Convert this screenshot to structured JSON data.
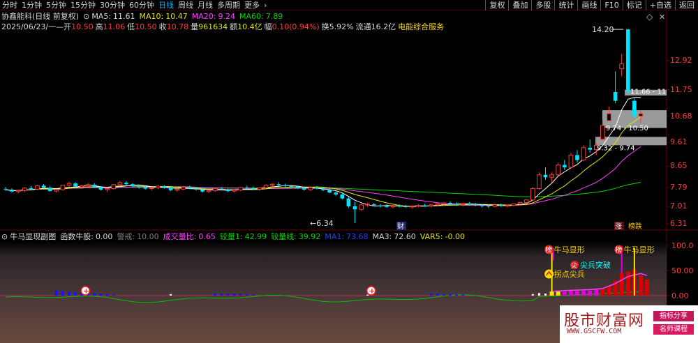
{
  "toolbar": {
    "timeframes": [
      "分时",
      "1分钟",
      "5分钟",
      "15分钟",
      "30分钟",
      "60分钟",
      "日线",
      "周线",
      "月线",
      "多周期",
      "更多"
    ],
    "active": "日线",
    "right_buttons": [
      "复权",
      "叠加",
      "多股",
      "统计",
      "画线",
      "F10",
      "标记",
      "+自选",
      "返回"
    ]
  },
  "stock": {
    "name": "协鑫能科",
    "adjust": "(日线 前复权)",
    "ma5_label": "MA5:",
    "ma5": "11.61",
    "ma10_label": "MA10:",
    "ma10": "10.47",
    "ma20_label": "MA20:",
    "ma20": "9.24",
    "ma60_label": "MA60:",
    "ma60": "7.89",
    "date": "2025/06/23/一",
    "open_label": "开",
    "open": "10.50",
    "high_label": "高",
    "high": "11.06",
    "low_label": "低",
    "low": "10.50",
    "close_label": "收",
    "close": "10.78",
    "vol_label": "量",
    "vol": "961634",
    "amt_label": "额",
    "amt": "10.4亿",
    "chg_label": "幅",
    "chg": "0.10(0.94%)",
    "turn_label": "换",
    "turn": "5.92%",
    "float_label": "流通",
    "float": "16.2亿",
    "sector": "电能综合服务",
    "close_x": "✕",
    "diamond": "◇"
  },
  "price_axis": [
    "12.92",
    "11.75",
    "10.68",
    "9.61",
    "8.65",
    "7.79",
    "7.01",
    "6.31"
  ],
  "annotations": {
    "high": "14.20",
    "low": "6.34",
    "gap1": "11.66 - 11",
    "gap2": "9.74 - 10.50",
    "gap3": "9.32 - 9.74",
    "cai": "财",
    "zhang": "涨",
    "bangdie": "榜跌"
  },
  "indicator": {
    "name": "牛马显现副图",
    "fn_label": "函数牛股:",
    "fn_value": "0.00",
    "warn_label": "警戒:",
    "warn_value": "10.00",
    "ratio_label": "成交量比:",
    "ratio_value": "0.65",
    "vol1_label": "较量1:",
    "vol1_value": "42.99",
    "volline_label": "较量线:",
    "volline_value": "39.92",
    "ma1_label": "MA1:",
    "ma1_value": "73.68",
    "ma3_label": "MA3:",
    "ma3_value": "72.60",
    "var5_label": "VAR5:",
    "var5_value": "-0.00",
    "axis": [
      "100.0",
      "50.00",
      "0.00"
    ],
    "tag_bang": "榜",
    "tag_niuma1": "牛马显形",
    "tag_niuma2": "牛马显形",
    "tag_guaidian": "拐点尖兵",
    "tag_jianbing": "尖兵突破",
    "badge_jian": "尖",
    "plus": "+"
  },
  "watermark": {
    "main": "股市财富网",
    "url": "WWW.GSCFW.COM",
    "tag1": "指标分享",
    "tag2": "名师课程"
  },
  "colors": {
    "up": "#ff3c3c",
    "down": "#00e5ff",
    "ma5": "#ffffff",
    "ma10": "#e7e700",
    "ma20": "#ff40ff",
    "ma60": "#00d700",
    "bar_blue": "#1414ff",
    "bar_magenta": "#e000e0",
    "bar_red": "#dd0000",
    "bar_yellow": "#ffe000"
  },
  "chart_data": {
    "type": "candlestick",
    "title": "协鑫能科 (日线 前复权)",
    "ylim": [
      6.2,
      14.6
    ],
    "candles": [
      [
        7.72,
        7.8,
        7.65,
        7.7
      ],
      [
        7.7,
        7.75,
        7.58,
        7.62
      ],
      [
        7.62,
        7.7,
        7.55,
        7.66
      ],
      [
        7.66,
        7.8,
        7.6,
        7.76
      ],
      [
        7.76,
        7.85,
        7.7,
        7.72
      ],
      [
        7.72,
        7.9,
        7.68,
        7.86
      ],
      [
        7.86,
        7.92,
        7.75,
        7.78
      ],
      [
        7.78,
        7.85,
        7.62,
        7.64
      ],
      [
        7.64,
        7.72,
        7.58,
        7.7
      ],
      [
        7.7,
        7.9,
        7.66,
        7.88
      ],
      [
        7.88,
        8.02,
        7.82,
        7.95
      ],
      [
        7.95,
        8.0,
        7.8,
        7.82
      ],
      [
        7.82,
        7.9,
        7.74,
        7.86
      ],
      [
        7.86,
        7.96,
        7.8,
        7.9
      ],
      [
        7.9,
        7.96,
        7.76,
        7.78
      ],
      [
        7.78,
        7.84,
        7.66,
        7.7
      ],
      [
        7.7,
        7.78,
        7.6,
        7.74
      ],
      [
        7.74,
        7.92,
        7.7,
        7.9
      ],
      [
        7.9,
        8.05,
        7.84,
        7.98
      ],
      [
        7.98,
        8.04,
        7.88,
        7.92
      ],
      [
        7.92,
        7.96,
        7.8,
        7.84
      ],
      [
        7.84,
        7.9,
        7.74,
        7.8
      ],
      [
        7.8,
        7.86,
        7.7,
        7.74
      ],
      [
        7.74,
        7.8,
        7.66,
        7.78
      ],
      [
        7.78,
        7.88,
        7.72,
        7.84
      ],
      [
        7.84,
        7.88,
        7.74,
        7.76
      ],
      [
        7.76,
        7.82,
        7.64,
        7.68
      ],
      [
        7.68,
        7.76,
        7.62,
        7.72
      ],
      [
        7.72,
        7.84,
        7.68,
        7.8
      ],
      [
        7.8,
        7.86,
        7.72,
        7.74
      ],
      [
        7.74,
        7.8,
        7.66,
        7.7
      ],
      [
        7.7,
        7.76,
        7.58,
        7.62
      ],
      [
        7.62,
        7.7,
        7.56,
        7.66
      ],
      [
        7.66,
        7.78,
        7.62,
        7.74
      ],
      [
        7.74,
        7.8,
        7.66,
        7.7
      ],
      [
        7.7,
        7.74,
        7.6,
        7.64
      ],
      [
        7.64,
        7.72,
        7.58,
        7.68
      ],
      [
        7.68,
        7.8,
        7.64,
        7.78
      ],
      [
        7.78,
        7.86,
        7.72,
        7.76
      ],
      [
        7.76,
        7.82,
        7.68,
        7.72
      ],
      [
        7.72,
        7.8,
        7.66,
        7.78
      ],
      [
        7.78,
        7.92,
        7.74,
        7.88
      ],
      [
        7.88,
        7.96,
        7.8,
        7.92
      ],
      [
        7.92,
        8.0,
        7.84,
        7.88
      ],
      [
        7.88,
        7.94,
        7.8,
        7.84
      ],
      [
        7.84,
        7.9,
        7.76,
        7.8
      ],
      [
        7.8,
        7.86,
        7.72,
        7.76
      ],
      [
        7.76,
        7.82,
        7.66,
        7.7
      ],
      [
        7.7,
        7.8,
        7.64,
        7.78
      ],
      [
        7.78,
        7.84,
        7.7,
        7.74
      ],
      [
        7.74,
        7.8,
        7.64,
        7.68
      ],
      [
        7.68,
        7.74,
        7.55,
        7.58
      ],
      [
        7.58,
        7.66,
        7.45,
        7.5
      ],
      [
        7.5,
        7.56,
        7.3,
        7.34
      ],
      [
        7.34,
        7.4,
        6.95,
        7.02
      ],
      [
        7.02,
        7.2,
        6.34,
        6.9
      ],
      [
        6.9,
        7.12,
        6.85,
        7.08
      ],
      [
        7.08,
        7.18,
        7.0,
        7.1
      ],
      [
        7.1,
        7.16,
        7.02,
        7.06
      ],
      [
        7.06,
        7.12,
        6.98,
        7.04
      ],
      [
        7.04,
        7.1,
        6.96,
        7.0
      ],
      [
        7.0,
        7.08,
        6.94,
        7.04
      ],
      [
        7.04,
        7.1,
        6.98,
        7.02
      ],
      [
        7.02,
        7.08,
        6.96,
        7.0
      ],
      [
        7.0,
        7.06,
        6.94,
        7.02
      ],
      [
        7.02,
        7.1,
        6.98,
        7.06
      ],
      [
        7.06,
        7.12,
        7.0,
        7.04
      ],
      [
        7.04,
        7.1,
        6.98,
        7.08
      ],
      [
        7.08,
        7.16,
        7.02,
        7.12
      ],
      [
        7.12,
        7.2,
        7.06,
        7.16
      ],
      [
        7.16,
        7.22,
        7.08,
        7.12
      ],
      [
        7.12,
        7.18,
        7.04,
        7.1
      ],
      [
        7.1,
        7.16,
        7.02,
        7.14
      ],
      [
        7.14,
        7.2,
        7.06,
        7.1
      ],
      [
        7.1,
        7.16,
        7.02,
        7.06
      ],
      [
        7.06,
        7.12,
        6.98,
        7.04
      ],
      [
        7.04,
        7.1,
        6.96,
        7.02
      ],
      [
        7.02,
        7.1,
        6.98,
        7.08
      ],
      [
        7.08,
        7.14,
        7.0,
        7.04
      ],
      [
        7.04,
        7.1,
        6.98,
        7.06
      ],
      [
        7.06,
        7.14,
        7.02,
        7.12
      ],
      [
        7.12,
        7.2,
        7.06,
        7.18
      ],
      [
        7.18,
        7.3,
        7.12,
        7.28
      ],
      [
        7.28,
        7.8,
        7.24,
        7.74
      ],
      [
        7.74,
        8.4,
        7.7,
        8.3
      ],
      [
        8.3,
        8.6,
        8.1,
        8.2
      ],
      [
        8.2,
        8.4,
        8.0,
        8.3
      ],
      [
        8.3,
        8.8,
        8.26,
        8.7
      ],
      [
        8.7,
        8.9,
        8.5,
        8.6
      ],
      [
        8.6,
        9.2,
        8.55,
        9.1
      ],
      [
        9.1,
        9.3,
        8.8,
        8.9
      ],
      [
        8.9,
        9.5,
        8.85,
        9.4
      ],
      [
        9.4,
        9.74,
        9.2,
        9.32
      ],
      [
        9.32,
        9.6,
        9.1,
        9.5
      ],
      [
        9.74,
        10.5,
        9.7,
        10.3
      ],
      [
        10.5,
        11.06,
        10.5,
        10.78
      ],
      [
        11.66,
        12.5,
        11.2,
        11.3
      ],
      [
        12.6,
        13.2,
        12.3,
        12.8
      ],
      [
        14.2,
        14.2,
        11.6,
        11.66
      ],
      [
        11.3,
        11.4,
        10.6,
        10.68
      ],
      [
        10.68,
        10.9,
        10.4,
        10.78
      ]
    ]
  }
}
